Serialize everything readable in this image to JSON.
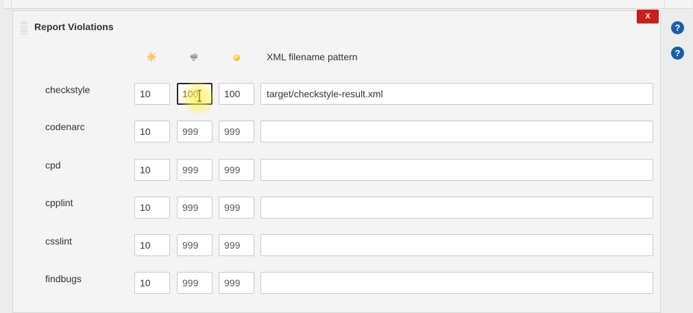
{
  "section": {
    "title": "Report Violations",
    "delete_label": "X",
    "help_label": "?"
  },
  "columns": {
    "icons": [
      "sunny-weather-icon",
      "cloudy-weather-icon",
      "yellow-ball-icon"
    ],
    "pattern_header": "XML filename pattern"
  },
  "rows": [
    {
      "name": "checkstyle",
      "sunny": "10",
      "stormy": "100",
      "unstable": "100",
      "pattern": "target/checkstyle-result.xml"
    },
    {
      "name": "codenarc",
      "sunny": "10",
      "stormy": "999",
      "unstable": "999",
      "pattern": ""
    },
    {
      "name": "cpd",
      "sunny": "10",
      "stormy": "999",
      "unstable": "999",
      "pattern": ""
    },
    {
      "name": "cpplint",
      "sunny": "10",
      "stormy": "999",
      "unstable": "999",
      "pattern": ""
    },
    {
      "name": "csslint",
      "sunny": "10",
      "stormy": "999",
      "unstable": "999",
      "pattern": ""
    },
    {
      "name": "findbugs",
      "sunny": "10",
      "stormy": "999",
      "unstable": "999",
      "pattern": ""
    }
  ],
  "colors": {
    "delete": "#c81e1e",
    "help": "#1a5ea8",
    "cursor_highlight": "#fff050"
  }
}
